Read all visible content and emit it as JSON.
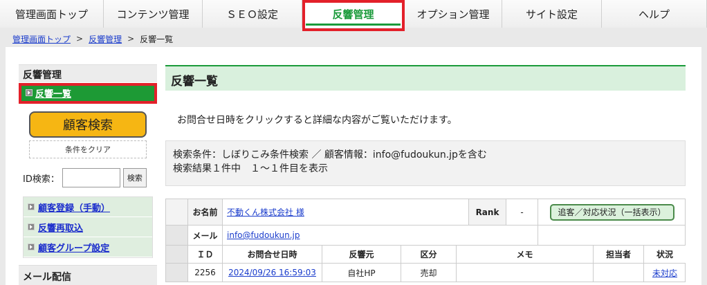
{
  "nav": {
    "tabs": [
      {
        "label": "管理画面トップ"
      },
      {
        "label": "コンテンツ管理"
      },
      {
        "label": "ＳＥＯ設定"
      },
      {
        "label": "反響管理"
      },
      {
        "label": "オプション管理"
      },
      {
        "label": "サイト設定"
      },
      {
        "label": "ヘルプ"
      }
    ],
    "active_index": 3
  },
  "breadcrumb": {
    "items": [
      "管理画面トップ",
      "反響管理",
      "反響一覧"
    ],
    "separator": ">"
  },
  "sidebar": {
    "section_title": "反響管理",
    "active_item": "反響一覧",
    "search_button": "顧客検索",
    "clear_button": "条件をクリア",
    "id_search_label": "ID検索：",
    "id_search_button": "検索",
    "links": [
      {
        "label": "顧客登録（手動）"
      },
      {
        "label": "反響再取込"
      },
      {
        "label": "顧客グループ設定"
      }
    ],
    "section2_title": "メール配信"
  },
  "content": {
    "title": "反響一覧",
    "notice": "お問合せ日時をクリックすると詳細な内容がご覧いただけます。",
    "conditions_line1": "検索条件：しぼりこみ条件検索 ／ 顧客情報：info@fudoukun.jpを含む",
    "conditions_line2": "検索結果１件中　１～１件目を表示"
  },
  "record": {
    "name_label": "お名前",
    "name_value": "不動くん株式会社 様",
    "rank_label": "Rank",
    "rank_value": "-",
    "follow_button": "追客／対応状況（一括表示）",
    "mail_label": "メール",
    "mail_value": "info@fudoukun.jp",
    "columns": [
      "ＩＤ",
      "お問合せ日時",
      "反響元",
      "区分",
      "メモ",
      "担当者",
      "状況"
    ],
    "row": {
      "id": "2256",
      "datetime": "2024/09/26 16:59:03",
      "source": "自社HP",
      "category": "売却",
      "memo": "",
      "staff": "",
      "status": "未対応"
    }
  },
  "colors": {
    "accent_green": "#1a9a3a",
    "highlight_red": "#e3202a",
    "search_button": "#f6b613",
    "link_blue": "#1a3ccc"
  }
}
